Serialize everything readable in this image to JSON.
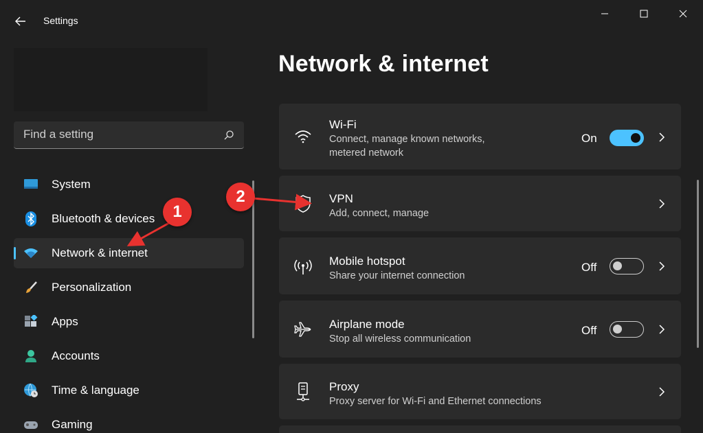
{
  "window": {
    "title": "Settings",
    "controls": [
      "minimize",
      "maximize",
      "close"
    ]
  },
  "search": {
    "placeholder": "Find a setting"
  },
  "sidebar": {
    "items": [
      {
        "label": "System",
        "icon": "monitor-icon"
      },
      {
        "label": "Bluetooth & devices",
        "icon": "bluetooth-icon"
      },
      {
        "label": "Network & internet",
        "icon": "wifi-icon",
        "active": true
      },
      {
        "label": "Personalization",
        "icon": "brush-icon"
      },
      {
        "label": "Apps",
        "icon": "apps-icon"
      },
      {
        "label": "Accounts",
        "icon": "person-icon"
      },
      {
        "label": "Time & language",
        "icon": "globe-clock-icon"
      },
      {
        "label": "Gaming",
        "icon": "gamepad-icon"
      }
    ]
  },
  "main": {
    "title": "Network & internet",
    "cards": [
      {
        "title": "Wi-Fi",
        "subtitle": "Connect, manage known networks, metered network",
        "icon": "wifi-icon",
        "toggle": "On"
      },
      {
        "title": "VPN",
        "subtitle": "Add, connect, manage",
        "icon": "shield-icon"
      },
      {
        "title": "Mobile hotspot",
        "subtitle": "Share your internet connection",
        "icon": "hotspot-icon",
        "toggle": "Off"
      },
      {
        "title": "Airplane mode",
        "subtitle": "Stop all wireless communication",
        "icon": "airplane-icon",
        "toggle": "Off"
      },
      {
        "title": "Proxy",
        "subtitle": "Proxy server for Wi-Fi and Ethernet connections",
        "icon": "proxy-icon"
      }
    ]
  },
  "annotations": {
    "marker1": "1",
    "marker2": "2"
  },
  "colors": {
    "accent": "#4cc2ff",
    "marker": "#e8322f",
    "background": "#202020",
    "card": "#2b2b2b"
  }
}
